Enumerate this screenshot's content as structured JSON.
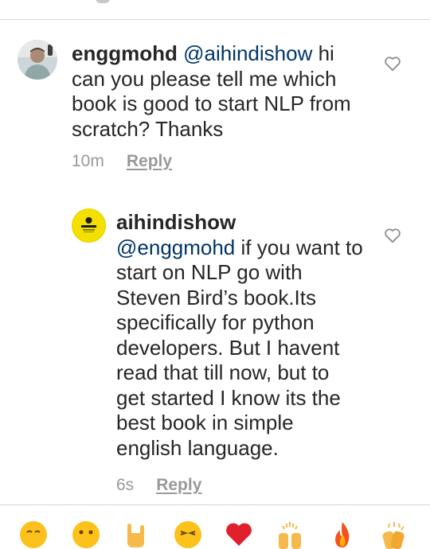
{
  "comments": [
    {
      "username": "enggmohd",
      "mention": "@aihindishow",
      "text": " hi can you please tell me which book is good to start NLP from scratch? Thanks",
      "time": "10m",
      "reply_label": "Reply",
      "avatar_icon": "user-avatar-photo"
    },
    {
      "username": "aihindishow",
      "mention": "@enggmohd",
      "text": " if you want to start on NLP go with Steven Bird’s book.Its specifically for python developers. But I havent read that till now, but to get started I know its the best book in simple english  language.",
      "time": "6s",
      "reply_label": "Reply",
      "avatar_icon": "channel-logo-avatar"
    }
  ],
  "icons": {
    "like": "heart-outline-icon"
  },
  "emoji_bar": [
    "grinning-face-emoji",
    "smiling-face-emoji",
    "rock-hand-emoji",
    "laughing-face-emoji",
    "red-heart-emoji",
    "raised-hands-emoji",
    "fire-emoji",
    "clapping-hands-emoji"
  ],
  "colors": {
    "text": "#262626",
    "muted": "#999999",
    "mention": "#003569",
    "divider": "#dbdbdb",
    "channel_avatar": "#f4e000"
  }
}
